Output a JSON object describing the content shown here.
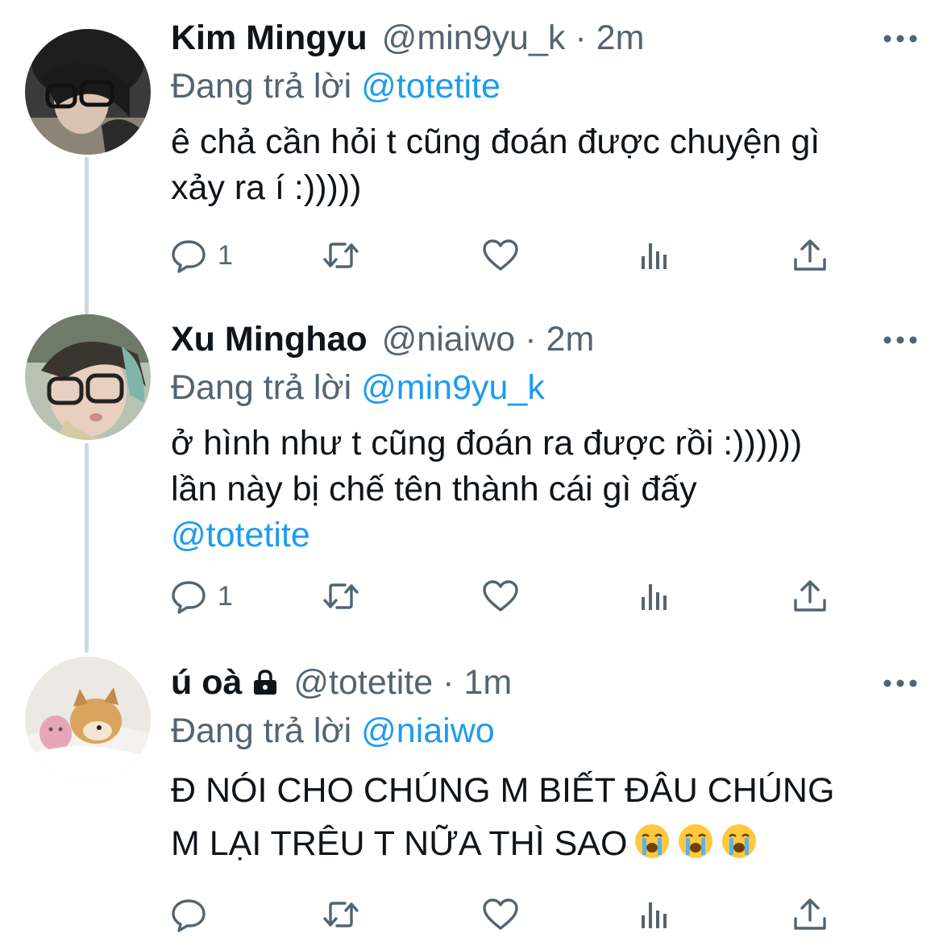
{
  "tweets": [
    {
      "name": "Kim Mingyu",
      "handle": "@min9yu_k",
      "separator": "·",
      "time": "2m",
      "replying_prefix": "Đang trả lời",
      "replying_to": "@totetite",
      "text_lines": [
        "ê chả cần hỏi t cũng đoán được chuyện gì",
        "xảy ra í :)))))"
      ],
      "reply_count": "1",
      "locked": false
    },
    {
      "name": "Xu Minghao",
      "handle": "@niaiwo",
      "separator": "·",
      "time": "2m",
      "replying_prefix": "Đang trả lời",
      "replying_to": "@min9yu_k",
      "text_lines": [
        "ở hình như t cũng đoán ra được rồi :))))))",
        "lần này bị chế tên thành cái gì đấy"
      ],
      "mention_line": "@totetite",
      "reply_count": "1",
      "locked": false
    },
    {
      "name": "ú oà",
      "handle": "@totetite",
      "separator": "·",
      "time": "1m",
      "replying_prefix": "Đang trả lời",
      "replying_to": "@niaiwo",
      "text_lines": [
        "Đ NÓI CHO CHÚNG M BIẾT ĐÂU CHÚNG",
        "M LẠI TRÊU T NỮA THÌ SAO"
      ],
      "emojis": [
        "loudly-crying-face",
        "loudly-crying-face",
        "loudly-crying-face"
      ],
      "reply_count": "",
      "locked": true
    }
  ],
  "icons": {
    "reply": "reply-icon",
    "retweet": "retweet-icon",
    "like": "like-icon",
    "analytics": "analytics-icon",
    "share": "share-icon",
    "more": "more-icon",
    "lock": "lock-icon"
  },
  "colors": {
    "text": "#0f1419",
    "secondary": "#536471",
    "link": "#1d9bf0",
    "thread_line": "#cfd9de"
  }
}
